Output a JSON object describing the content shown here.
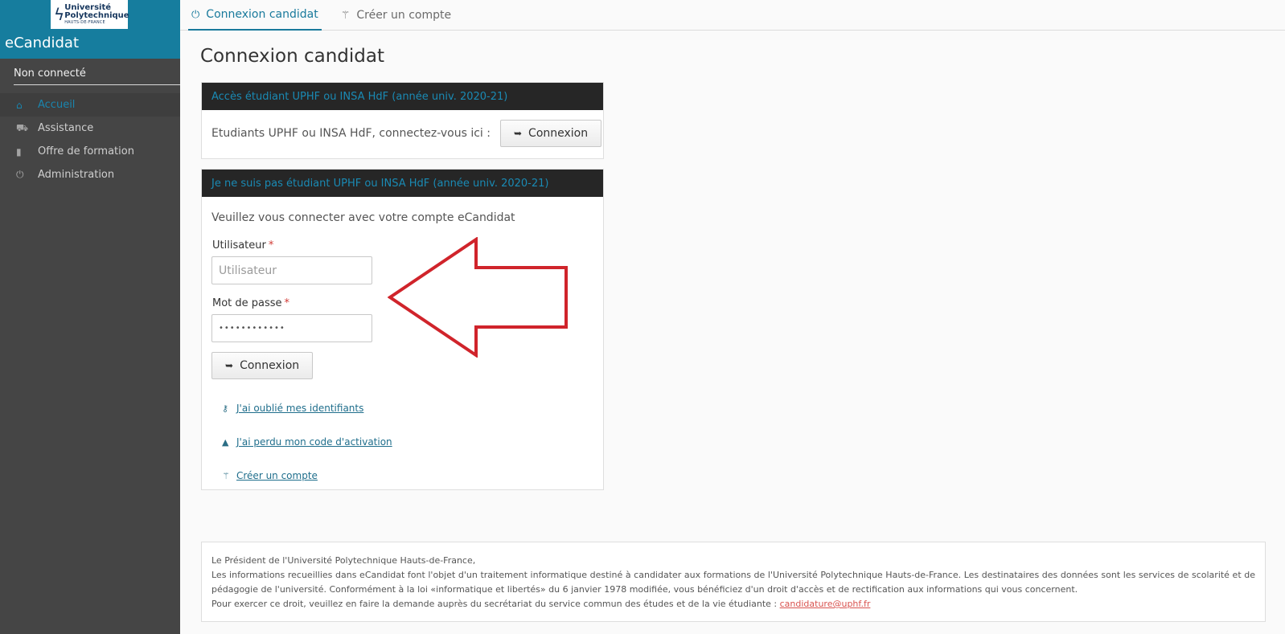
{
  "sidebar": {
    "logo": {
      "line1": "Université",
      "line2": "Polytechnique",
      "line3": "HAUTS-DE-FRANCE"
    },
    "app_title": "eCandidat",
    "user_status": "Non connecté",
    "items": [
      {
        "label": "Accueil",
        "icon": "home-icon",
        "active": true
      },
      {
        "label": "Assistance",
        "icon": "ambulance-icon",
        "active": false
      },
      {
        "label": "Offre de formation",
        "icon": "bookmark-icon",
        "active": false
      },
      {
        "label": "Administration",
        "icon": "power-icon",
        "active": false
      }
    ]
  },
  "tabs": [
    {
      "label": "Connexion candidat",
      "icon": "power-icon",
      "active": true
    },
    {
      "label": "Créer un compte",
      "icon": "magic-wand-icon",
      "active": false
    }
  ],
  "main": {
    "title": "Connexion candidat",
    "panel_student": {
      "header": "Accès étudiant UPHF ou INSA HdF (année univ. 2020-21)",
      "text": "Etudiants UPHF ou INSA HdF, connectez-vous ici :",
      "button_label": "Connexion"
    },
    "panel_other": {
      "header": "Je ne suis pas étudiant UPHF ou INSA HdF (année univ. 2020-21)",
      "intro": "Veuillez vous connecter avec votre compte eCandidat",
      "user_label": "Utilisateur",
      "user_placeholder": "Utilisateur",
      "pass_label": "Mot de passe",
      "pass_value": "••••••••••••",
      "required_mark": "*",
      "button_label": "Connexion",
      "links": [
        {
          "label": "J'ai oublié mes identifiants",
          "icon": "key-icon"
        },
        {
          "label": "J'ai perdu mon code d'activation",
          "icon": "lock-icon"
        },
        {
          "label": "Créer un compte",
          "icon": "magic-wand-icon"
        }
      ]
    }
  },
  "footer": {
    "line1": "Le Président de l'Université Polytechnique Hauts-de-France,",
    "line2": "Les informations recueillies dans eCandidat font l'objet d'un traitement informatique destiné à candidater aux formations de l'Université Polytechnique Hauts-de-France. Les destinataires des données sont les services de scolarité et de pédagogie de l'université. Conformément à la loi «informatique et libertés» du 6 janvier 1978 modifiée, vous bénéficiez d'un droit d'accès et de rectification aux informations qui vous concernent.",
    "line3": "Pour exercer ce droit, veuillez en faire la demande auprès du secrétariat du service commun des études et de la vie étudiante :",
    "email": "candidature@uphf.fr"
  },
  "colors": {
    "accent": "#167d9e",
    "sidebar_bg": "#454545",
    "panel_header_bg": "#262626",
    "arrow": "#d0242b"
  }
}
